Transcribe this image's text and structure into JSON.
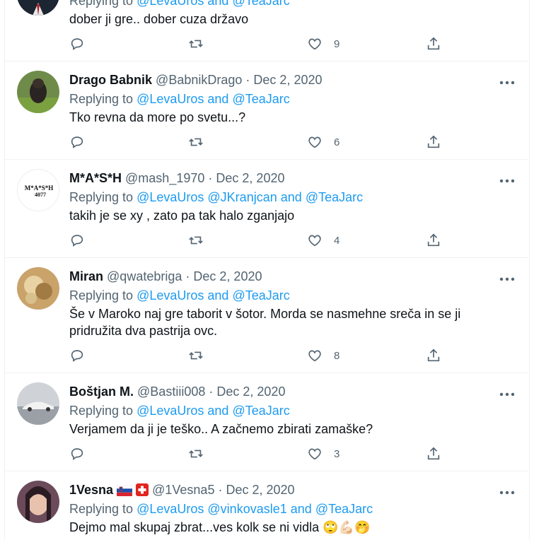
{
  "tweets": [
    {
      "name": "",
      "handle": "",
      "date": "",
      "replying_prefix": "Replying to",
      "mentions": [
        "@LevaUros"
      ],
      "last_mention": "@TeaJarc",
      "and": "and",
      "text": "dober ji gre.. dober cuza državo",
      "likes": "9"
    },
    {
      "name": "Drago Babnik",
      "handle": "@BabnikDrago",
      "date": "Dec 2, 2020",
      "replying_prefix": "Replying to",
      "mentions": [
        "@LevaUros"
      ],
      "last_mention": "@TeaJarc",
      "and": "and",
      "text": "Tko revna da more po svetu...?",
      "likes": "6"
    },
    {
      "name": "M*A*S*H",
      "handle": "@mash_1970",
      "date": "Dec 2, 2020",
      "replying_prefix": "Replying to",
      "mentions": [
        "@LevaUros",
        "@JKranjcan"
      ],
      "last_mention": "@TeaJarc",
      "and": "and",
      "text": "takih je se xy , zato pa tak halo zganjajo",
      "likes": "4",
      "avatar_text": "M*A*S*H 4077"
    },
    {
      "name": "Miran",
      "handle": "@qwatebriga",
      "date": "Dec 2, 2020",
      "replying_prefix": "Replying to",
      "mentions": [
        "@LevaUros"
      ],
      "last_mention": "@TeaJarc",
      "and": "and",
      "text": "Še v Maroko naj gre taborit v šotor. Morda se nasmehne sreča in se ji pridružita dva pastrija ovc.",
      "likes": "8"
    },
    {
      "name": "Boštjan M.",
      "handle": "@Bastiii008",
      "date": "Dec 2, 2020",
      "replying_prefix": "Replying to",
      "mentions": [
        "@LevaUros"
      ],
      "last_mention": "@TeaJarc",
      "and": "and",
      "text": "Verjamem da ji je teško.. A začnemo zbirati zamaške?",
      "likes": "3"
    },
    {
      "name": "1Vesna",
      "handle": "@1Vesna5",
      "date": "Dec 2, 2020",
      "replying_prefix": "Replying to",
      "mentions": [
        "@LevaUros",
        "@vinkovasle1"
      ],
      "last_mention": "@TeaJarc",
      "and": "and",
      "text": "Dejmo mal skupaj zbrat...ves kolk se ni vidla 🙄💪🏻🤭",
      "likes": ""
    }
  ],
  "separator": "·",
  "colors": {
    "link": "#1d9bf0",
    "muted": "#536471",
    "text": "#0f1419",
    "border": "#eff3f4"
  },
  "icons": {
    "reply": "reply-icon",
    "retweet": "retweet-icon",
    "like": "heart-icon",
    "share": "share-icon",
    "more": "more-icon"
  }
}
